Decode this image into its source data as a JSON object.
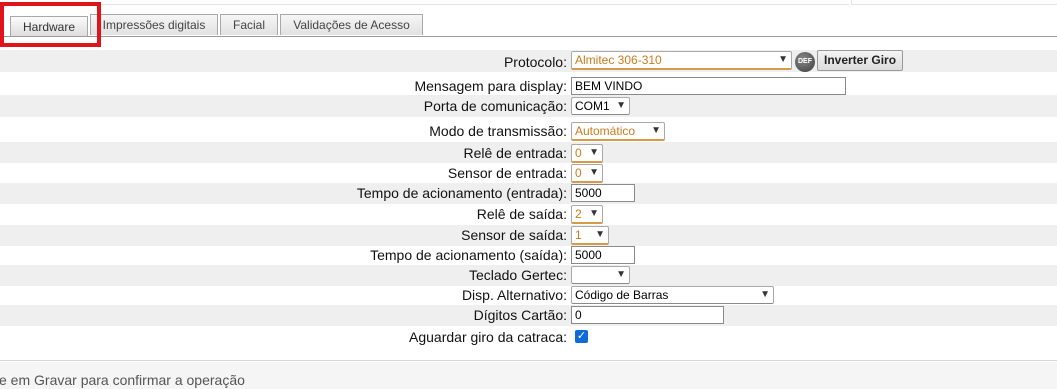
{
  "tabs": [
    "Hardware",
    "Impressões digitais",
    "Facial",
    "Validações de Acesso"
  ],
  "form": {
    "protocolo_label": "Protocolo:",
    "protocolo_value": "Almitec 306-310",
    "def_icon_text": "DEF",
    "inverter_giro_label": "Inverter Giro",
    "mensagem_label": "Mensagem para display:",
    "mensagem_value": "BEM VINDO",
    "porta_label": "Porta de comunicação:",
    "porta_value": "COM1",
    "modo_label": "Modo de transmissão:",
    "modo_value": "Automático",
    "rele_entrada_label": "Relê de entrada:",
    "rele_entrada_value": "0",
    "sensor_entrada_label": "Sensor de entrada:",
    "sensor_entrada_value": "0",
    "tempo_entrada_label": "Tempo de acionamento (entrada):",
    "tempo_entrada_value": "5000",
    "rele_saida_label": "Relê de saída:",
    "rele_saida_value": "2",
    "sensor_saida_label": "Sensor de saída:",
    "sensor_saida_value": "1",
    "tempo_saida_label": "Tempo de acionamento (saída):",
    "tempo_saida_value": "5000",
    "teclado_label": "Teclado Gertec:",
    "teclado_value": "",
    "disp_label": "Disp. Alternativo:",
    "disp_value": "Código de Barras",
    "digitos_label": "Dígitos Cartão:",
    "digitos_value": "0",
    "aguardar_label": "Aguardar giro da catraca:",
    "aguardar_checked": true
  },
  "footer_text": "e em Gravar para confirmar a operação",
  "colors": {
    "highlight": "#e0141b",
    "select_accent": "#cc7a1e",
    "checkbox": "#0f6bd8"
  }
}
